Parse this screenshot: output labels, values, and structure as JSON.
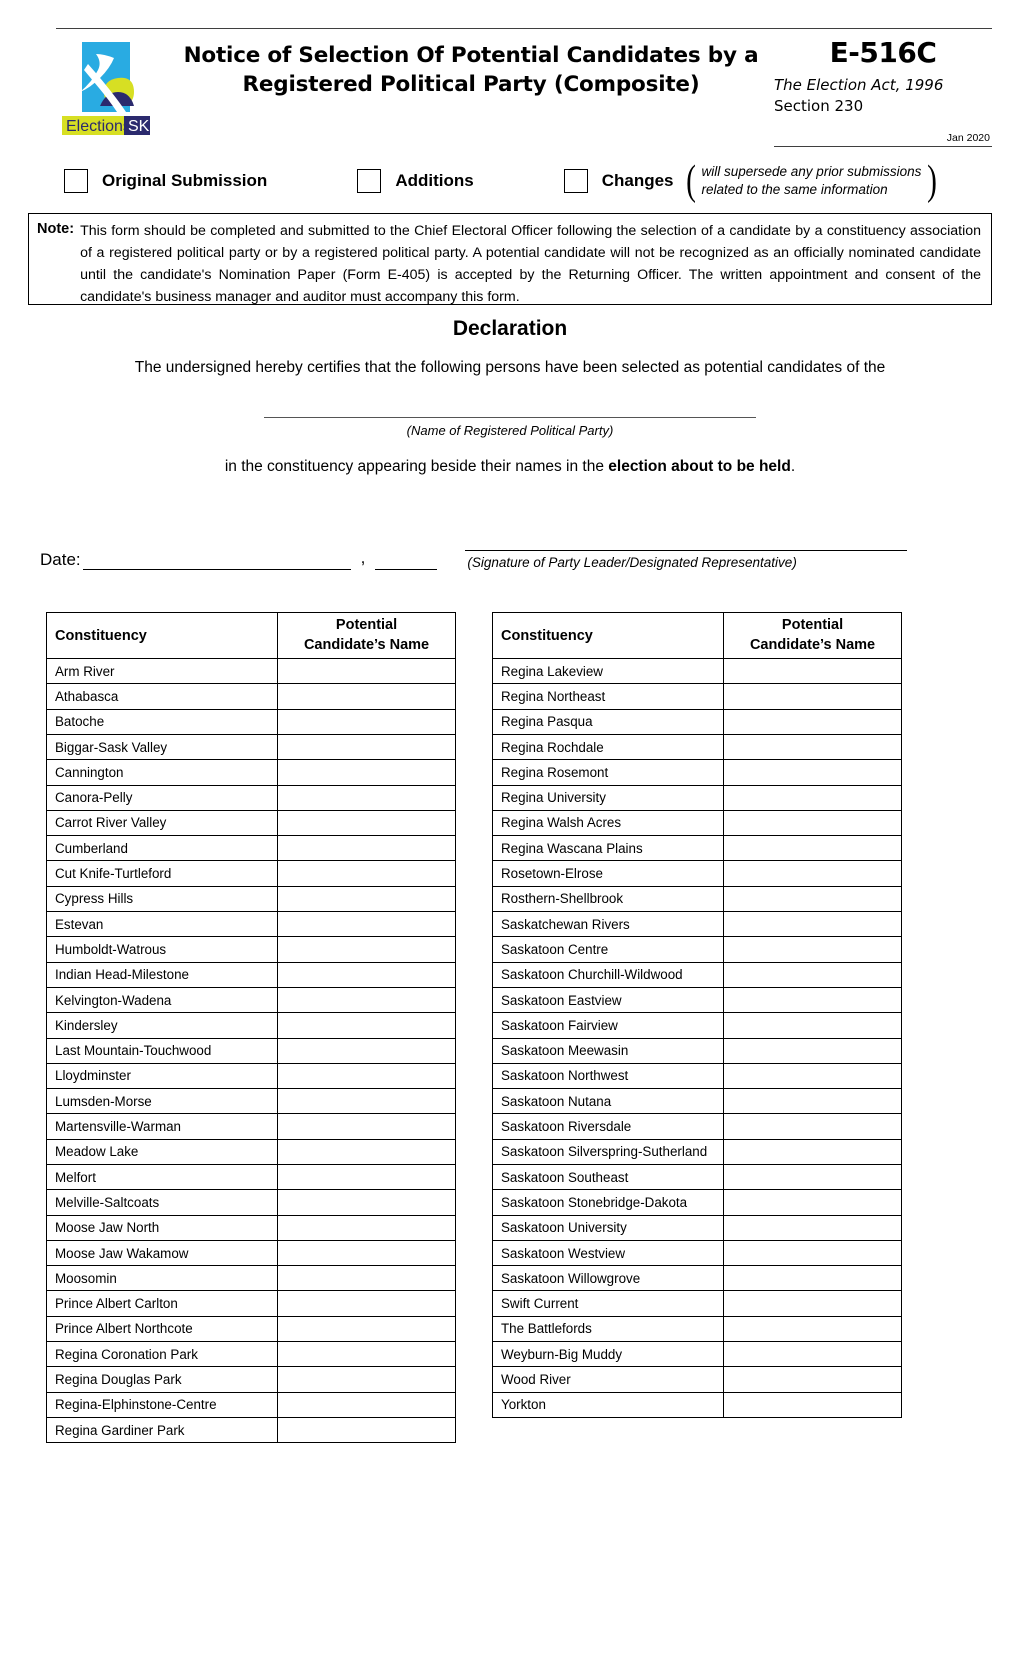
{
  "header": {
    "logo_alt": "Elections SK",
    "logo_word_elections": "Elections",
    "logo_word_sk": "SK",
    "title": "Notice of Selection Of Potential Candidates by a Registered Political Party (Composite)",
    "form_code": "E-516C",
    "act": "The Election Act, 1996",
    "section": "Section 230",
    "revision_date": "Jan 2020",
    "colors": {
      "logo_cyan": "#29ABE2",
      "logo_lime": "#D7DF23",
      "logo_navy": "#2B2A6E"
    }
  },
  "submission_type": {
    "options": [
      {
        "label": "Original Submission",
        "checked": false
      },
      {
        "label": "Additions",
        "checked": false
      },
      {
        "label": "Changes",
        "checked": false
      }
    ],
    "note_line1": "will supersede any prior submissions",
    "note_line2": "related to the same information"
  },
  "note": {
    "label": "Note:",
    "text": "This form should be completed and submitted to the Chief Electoral Officer following the selection of a candidate by a constituency association of a registered political party or by a registered political party.  A potential candidate will not be recognized as an officially nominated candidate until the candidate's Nomination Paper (Form E-405) is accepted by the Returning Officer.  The written appointment and consent of the candidate's business manager and auditor must accompany this form."
  },
  "declaration": {
    "title": "Declaration",
    "line1": "The undersigned hereby certifies that the following persons have been selected as potential candidates of the",
    "party_field_value": "",
    "party_caption": "(Name of Registered Political Party)",
    "line2_prefix": "in the constituency appearing beside their names in the ",
    "line2_bold": "election about to be held",
    "line2_suffix": "."
  },
  "signature_block": {
    "date_label": "Date:",
    "date_value": "",
    "comma": ",",
    "year_value": "",
    "signature_value": "",
    "signature_caption": "(Signature of Party Leader/Designated Representative)"
  },
  "tables": {
    "columns": {
      "constituency": "Constituency",
      "candidate_line1": "Potential",
      "candidate_line2": "Candidate’s Name"
    },
    "left_rows": [
      {
        "constituency": "Arm River",
        "candidate": ""
      },
      {
        "constituency": "Athabasca",
        "candidate": ""
      },
      {
        "constituency": "Batoche",
        "candidate": ""
      },
      {
        "constituency": "Biggar-Sask Valley",
        "candidate": ""
      },
      {
        "constituency": "Cannington",
        "candidate": ""
      },
      {
        "constituency": "Canora-Pelly",
        "candidate": ""
      },
      {
        "constituency": "Carrot River Valley",
        "candidate": ""
      },
      {
        "constituency": "Cumberland",
        "candidate": ""
      },
      {
        "constituency": "Cut Knife-Turtleford",
        "candidate": ""
      },
      {
        "constituency": "Cypress Hills",
        "candidate": ""
      },
      {
        "constituency": "Estevan",
        "candidate": ""
      },
      {
        "constituency": "Humboldt-Watrous",
        "candidate": ""
      },
      {
        "constituency": "Indian Head-Milestone",
        "candidate": ""
      },
      {
        "constituency": "Kelvington-Wadena",
        "candidate": ""
      },
      {
        "constituency": "Kindersley",
        "candidate": ""
      },
      {
        "constituency": "Last Mountain-Touchwood",
        "candidate": ""
      },
      {
        "constituency": "Lloydminster",
        "candidate": ""
      },
      {
        "constituency": "Lumsden-Morse",
        "candidate": ""
      },
      {
        "constituency": "Martensville-Warman",
        "candidate": ""
      },
      {
        "constituency": "Meadow Lake",
        "candidate": ""
      },
      {
        "constituency": "Melfort",
        "candidate": ""
      },
      {
        "constituency": "Melville-Saltcoats",
        "candidate": ""
      },
      {
        "constituency": "Moose Jaw North",
        "candidate": ""
      },
      {
        "constituency": "Moose Jaw Wakamow",
        "candidate": ""
      },
      {
        "constituency": "Moosomin",
        "candidate": ""
      },
      {
        "constituency": "Prince Albert Carlton",
        "candidate": ""
      },
      {
        "constituency": "Prince Albert Northcote",
        "candidate": ""
      },
      {
        "constituency": "Regina Coronation Park",
        "candidate": ""
      },
      {
        "constituency": "Regina Douglas Park",
        "candidate": ""
      },
      {
        "constituency": "Regina-Elphinstone-Centre",
        "candidate": ""
      },
      {
        "constituency": "Regina Gardiner Park",
        "candidate": ""
      }
    ],
    "right_rows": [
      {
        "constituency": "Regina Lakeview",
        "candidate": ""
      },
      {
        "constituency": "Regina Northeast",
        "candidate": ""
      },
      {
        "constituency": "Regina Pasqua",
        "candidate": ""
      },
      {
        "constituency": "Regina Rochdale",
        "candidate": ""
      },
      {
        "constituency": "Regina Rosemont",
        "candidate": ""
      },
      {
        "constituency": "Regina University",
        "candidate": ""
      },
      {
        "constituency": "Regina Walsh Acres",
        "candidate": ""
      },
      {
        "constituency": "Regina Wascana Plains",
        "candidate": ""
      },
      {
        "constituency": "Rosetown-Elrose",
        "candidate": ""
      },
      {
        "constituency": "Rosthern-Shellbrook",
        "candidate": ""
      },
      {
        "constituency": "Saskatchewan Rivers",
        "candidate": ""
      },
      {
        "constituency": "Saskatoon Centre",
        "candidate": ""
      },
      {
        "constituency": "Saskatoon Churchill-Wildwood",
        "candidate": ""
      },
      {
        "constituency": "Saskatoon Eastview",
        "candidate": ""
      },
      {
        "constituency": "Saskatoon Fairview",
        "candidate": ""
      },
      {
        "constituency": "Saskatoon Meewasin",
        "candidate": ""
      },
      {
        "constituency": "Saskatoon Northwest",
        "candidate": ""
      },
      {
        "constituency": "Saskatoon Nutana",
        "candidate": ""
      },
      {
        "constituency": "Saskatoon Riversdale",
        "candidate": ""
      },
      {
        "constituency": "Saskatoon Silverspring-Sutherland",
        "candidate": ""
      },
      {
        "constituency": "Saskatoon Southeast",
        "candidate": ""
      },
      {
        "constituency": "Saskatoon Stonebridge-Dakota",
        "candidate": ""
      },
      {
        "constituency": "Saskatoon University",
        "candidate": ""
      },
      {
        "constituency": "Saskatoon Westview",
        "candidate": ""
      },
      {
        "constituency": "Saskatoon Willowgrove",
        "candidate": ""
      },
      {
        "constituency": "Swift Current",
        "candidate": ""
      },
      {
        "constituency": "The Battlefords",
        "candidate": ""
      },
      {
        "constituency": "Weyburn-Big Muddy",
        "candidate": ""
      },
      {
        "constituency": "Wood River",
        "candidate": ""
      },
      {
        "constituency": "Yorkton",
        "candidate": ""
      }
    ]
  }
}
